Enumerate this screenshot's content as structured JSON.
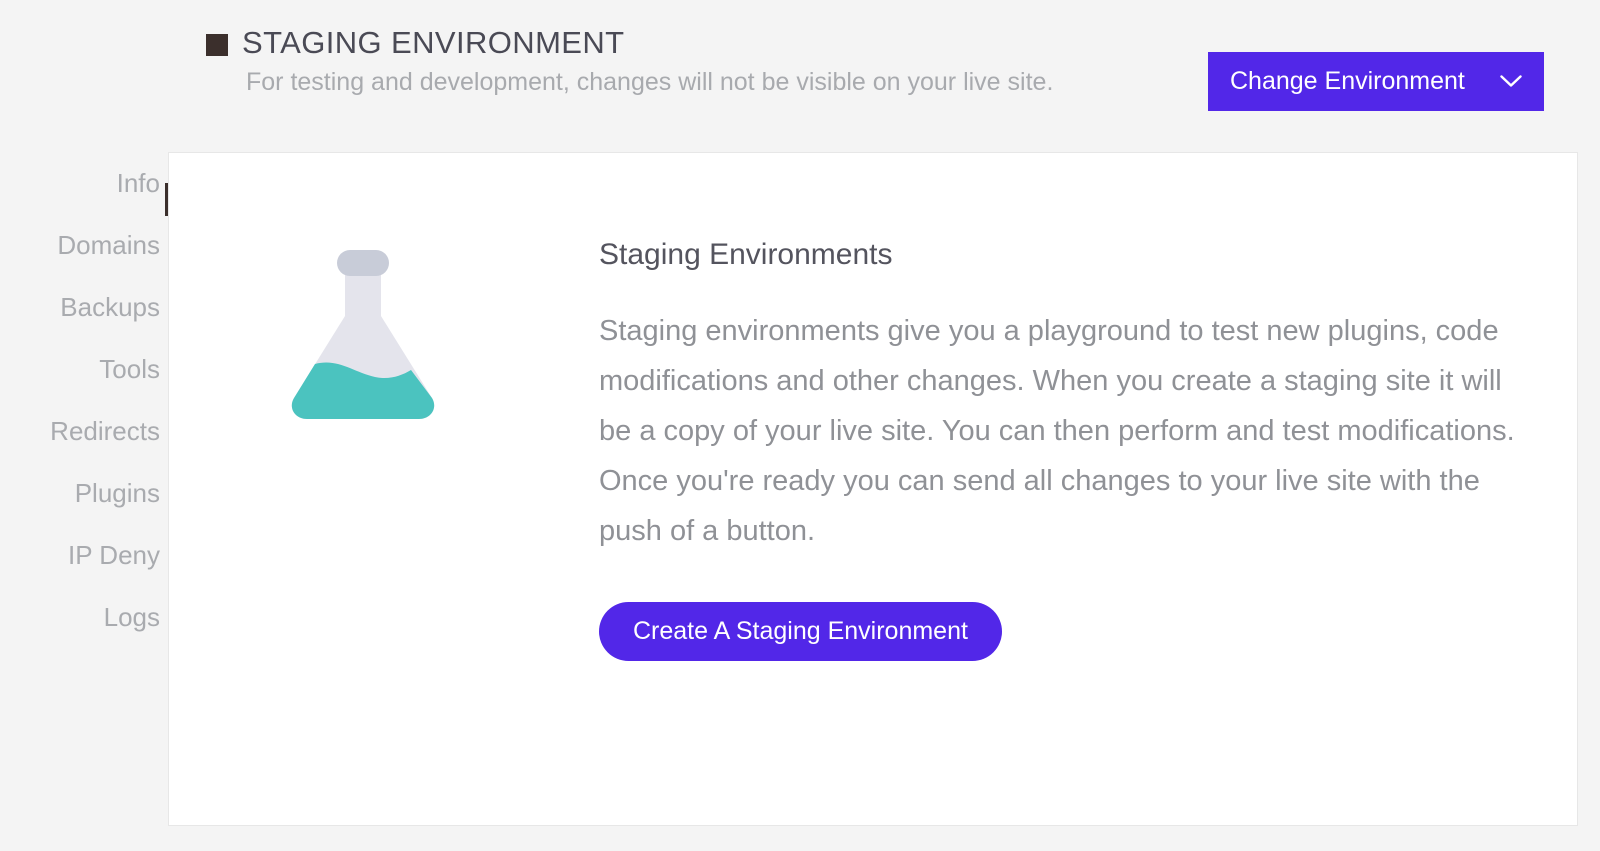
{
  "header": {
    "swatch_color": "#3b2f2c",
    "title": "STAGING ENVIRONMENT",
    "subtitle": "For testing and development, changes will not be visible on your live site.",
    "change_env_button": {
      "label": "Change Environment",
      "icon": "chevron-down-icon",
      "background": "#5227e8",
      "text_color": "#ffffff"
    }
  },
  "sidebar": {
    "active_item": "Info",
    "indicator_color": "#3b2f2c",
    "items": [
      {
        "label": "Info"
      },
      {
        "label": "Domains"
      },
      {
        "label": "Backups"
      },
      {
        "label": "Tools"
      },
      {
        "label": "Redirects"
      },
      {
        "label": "Plugins"
      },
      {
        "label": "IP Deny"
      },
      {
        "label": "Logs"
      }
    ]
  },
  "main": {
    "illustration": {
      "name": "flask-icon",
      "glass_color": "#e4e4ec",
      "cap_color": "#c8ccd8",
      "liquid_color": "#4bc3bf"
    },
    "heading": "Staging Environments",
    "body": "Staging environments give you a playground to test new plugins, code modifications and other changes. When you create a staging site it will be a copy of your live site. You can then perform and test modifications. Once you're ready you can send all changes to your live site with the push of a button.",
    "cta": {
      "label": "Create A Staging Environment",
      "background": "#5227e8",
      "text_color": "#ffffff"
    }
  },
  "theme": {
    "page_background": "#f4f4f4",
    "card_background": "#ffffff",
    "card_border": "#e7e7e7",
    "accent": "#5227e8",
    "muted_text": "#a9abaf",
    "body_text": "#8f9196",
    "heading_text": "#54545e"
  }
}
